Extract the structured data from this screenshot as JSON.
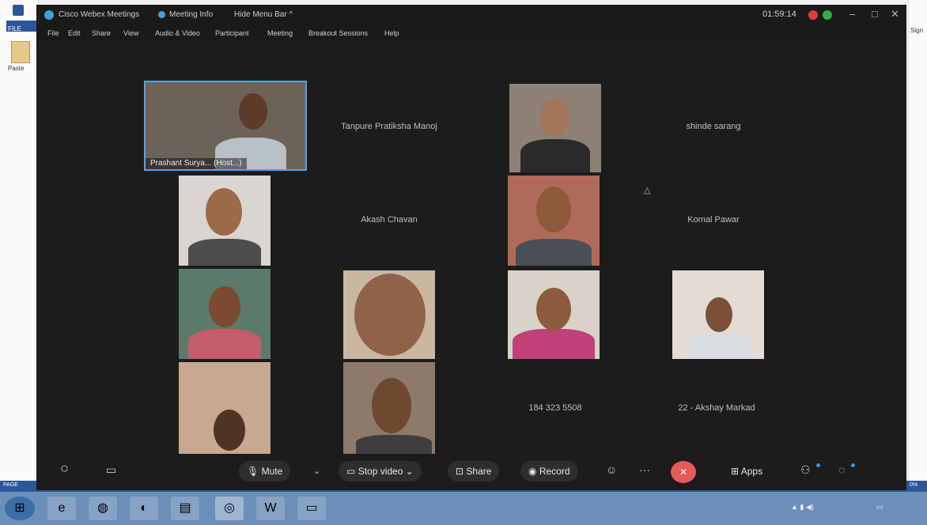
{
  "background_app": {
    "tab_label": "FILE",
    "paste_label": "Paste",
    "sign_label": "Sign",
    "status_left": "PAGE",
    "status_right": "0%"
  },
  "window": {
    "app_title": "Cisco Webex Meetings",
    "meeting_info": "Meeting Info",
    "hide_menu": "Hide Menu Bar ^",
    "timer": "01:59:14"
  },
  "menu": [
    "File",
    "Edit",
    "Share",
    "View",
    "Audio & Video",
    "Participant",
    "Meeting",
    "Breakout Sessions",
    "Help"
  ],
  "participants": {
    "host_name": "Prashant Surya... (Host...)",
    "name_1": "Tanpure Pratiksha Manoj",
    "name_2": "shinde sarang",
    "name_3": "Akash Chavan",
    "name_4": "Komal Pawar",
    "name_5": "184 323 5508",
    "name_6": "22 - Akshay Markad"
  },
  "controls": {
    "mute": "Mute",
    "stop_video": "Stop video",
    "share": "Share",
    "record": "Record",
    "apps": "Apps"
  },
  "colors": {
    "accent": "#39a3db",
    "end_call": "#e55a5a",
    "recording": "#e03b3b"
  }
}
